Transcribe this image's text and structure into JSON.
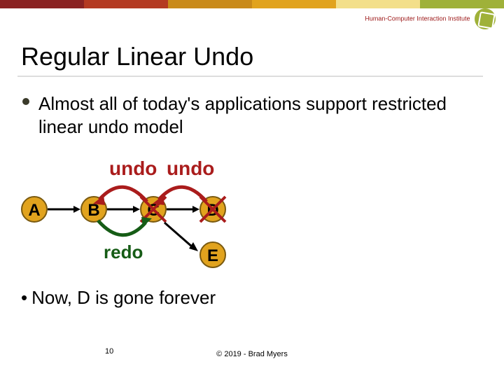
{
  "header": {
    "bar_colors": [
      "#8a2222",
      "#b43a22",
      "#c98a1a",
      "#e1a31e",
      "#f3df8a",
      "#9fb139"
    ],
    "institute": "Human-Computer Interaction Institute"
  },
  "title": "Regular Linear Undo",
  "bullet_main": "Almost all of today's applications support restricted linear undo model",
  "diagram": {
    "undo_label_1": "undo",
    "undo_label_2": "undo",
    "redo_label": "redo",
    "nodes": {
      "A": "A",
      "B": "B",
      "C": "C",
      "D": "D",
      "E": "E"
    }
  },
  "bullet_second": "Now, D is gone forever",
  "page_number": "10",
  "copyright": "© 2019 - Brad Myers"
}
